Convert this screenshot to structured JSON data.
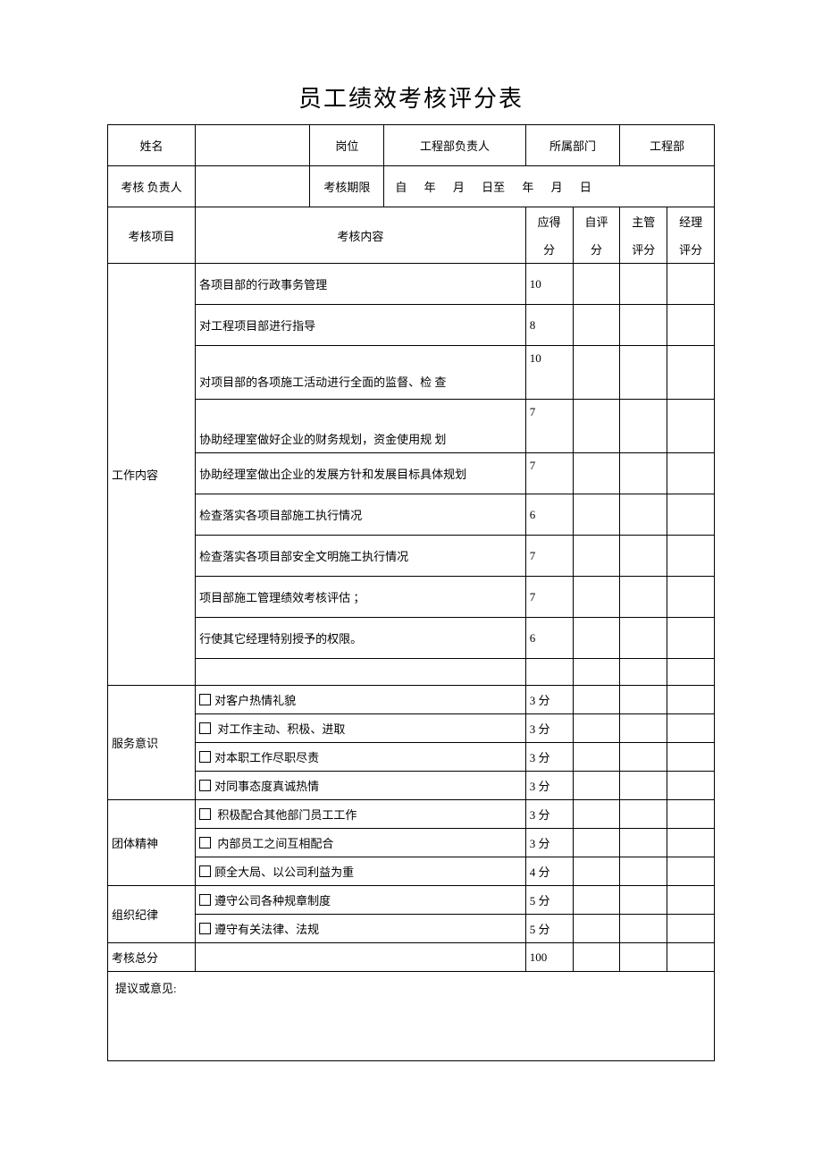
{
  "title": "员工绩效考核评分表",
  "header": {
    "name_label": "姓名",
    "name_value": "",
    "position_label": "岗位",
    "position_value": "工程部负责人",
    "dept_label": "所属部门",
    "dept_value": "工程部",
    "reviewer_label": "考核 负责人",
    "reviewer_value": "",
    "period_label": "考核期限",
    "period_from": "自",
    "year1": "年",
    "month1": "月",
    "dayto": "日至",
    "year2": "年",
    "month2": "月",
    "day2": "日"
  },
  "columns": {
    "item_label": "考核项目",
    "content_label": "考核内容",
    "expected_label1": "应得",
    "expected_label2": "分",
    "self_label1": "自评",
    "self_label2": "分",
    "sup_label1": "主管",
    "sup_label2": "评分",
    "mgr_label1": "经理",
    "mgr_label2": "评分"
  },
  "sections": {
    "work_content": {
      "label": "工作内容",
      "rows": [
        {
          "text": "各项目部的行政事务管理",
          "score": "10"
        },
        {
          "text": "对工程项目部进行指导",
          "score": "8"
        },
        {
          "text": "对项目部的各项施工活动进行全面的监督、检 查",
          "score": "10"
        },
        {
          "text": "协助经理室做好企业的财务规划，资金使用规 划",
          "score": "7"
        },
        {
          "text": "协助经理室做出企业的发展方针和发展目标具体规划",
          "score": "7"
        },
        {
          "text": "检查落实各项目部施工执行情况",
          "score": "6"
        },
        {
          "text": "检查落实各项目部安全文明施工执行情况",
          "score": "7"
        },
        {
          "text": "项目部施工管理绩效考核评估   ；",
          "score": "7"
        },
        {
          "text": "行使其它经理特别授予的权限。",
          "score": "6"
        },
        {
          "text": "",
          "score": ""
        }
      ]
    },
    "service": {
      "label": "服务意识",
      "rows": [
        {
          "text": "对客户热情礼貌",
          "score": "3 分"
        },
        {
          "text": " 对工作主动、积极、进取",
          "score": "3 分"
        },
        {
          "text": "对本职工作尽职尽责",
          "score": "3 分"
        },
        {
          "text": "对同事态度真诚热情",
          "score": "3 分"
        }
      ]
    },
    "team": {
      "label": "团体精神",
      "rows": [
        {
          "text": " 积极配合其他部门员工工作",
          "score": "3 分"
        },
        {
          "text": " 内部员工之间互相配合",
          "score": "3 分"
        },
        {
          "text": "顾全大局、以公司利益为重",
          "score": "4 分"
        }
      ]
    },
    "discipline": {
      "label": "组织纪律",
      "rows": [
        {
          "text": "遵守公司各种规章制度",
          "score": "5 分"
        },
        {
          "text": "遵守有关法律、法规",
          "score": "5 分"
        }
      ]
    }
  },
  "total": {
    "label": "考核总分",
    "score": "100"
  },
  "suggestion_label": "提议或意见:"
}
